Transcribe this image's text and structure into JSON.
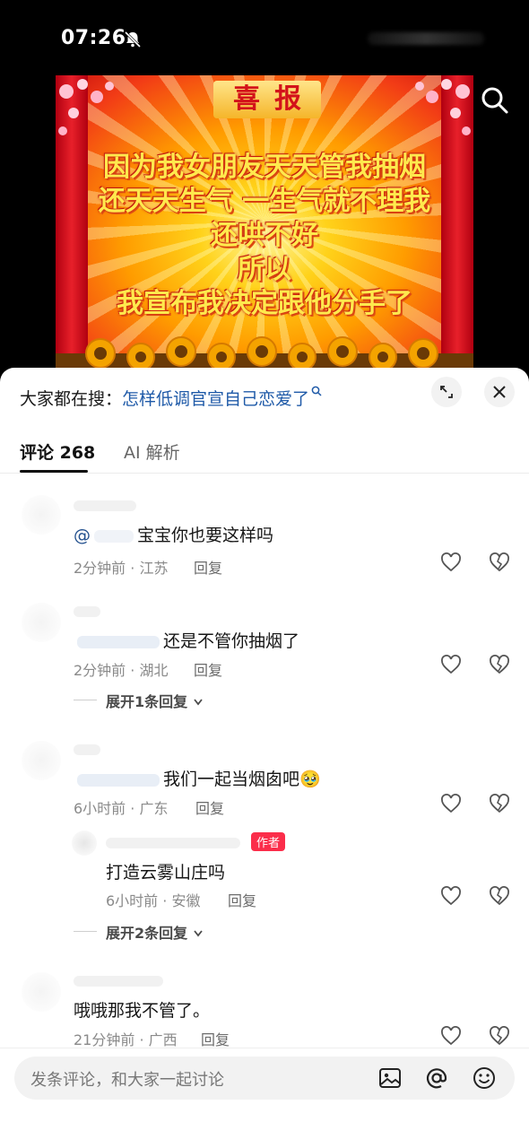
{
  "status": {
    "time": "07:26"
  },
  "hero": {
    "banner": "喜报",
    "lines": [
      "因为我女朋友天天管我抽烟",
      "还天天生气 一生气就不理我",
      "还哄不好",
      "所以",
      "我宣布我决定跟他分手了"
    ]
  },
  "sheet": {
    "search_prefix": "大家都在搜：",
    "search_query": "怎样低调官宣自己恋爱了",
    "tabs": {
      "comments": "评论 268",
      "ai": "AI 解析"
    }
  },
  "comments": [
    {
      "mention": "@",
      "text": "宝宝你也要这样吗",
      "meta": "2分钟前 · 江苏",
      "reply": "回复"
    },
    {
      "mention": "",
      "text": "还是不管你抽烟了",
      "meta": "2分钟前 · 湖北",
      "reply": "回复",
      "expand": "展开1条回复"
    },
    {
      "mention": "",
      "text": "我们一起当烟囱吧🥹",
      "meta": "6小时前 · 广东",
      "reply": "回复",
      "sub": {
        "badge": "作者",
        "text": "打造云雾山庄吗",
        "meta": "6小时前 · 安徽",
        "reply": "回复"
      },
      "expand": "展开2条回复"
    },
    {
      "mention": "",
      "text": "哦哦那我不管了。",
      "meta": "21分钟前 · 广西",
      "reply": "回复"
    }
  ],
  "input": {
    "placeholder": "发条评论，和大家一起讨论"
  },
  "colors": {
    "link": "#1f5aa8",
    "author_badge": "#fb2d4a"
  }
}
